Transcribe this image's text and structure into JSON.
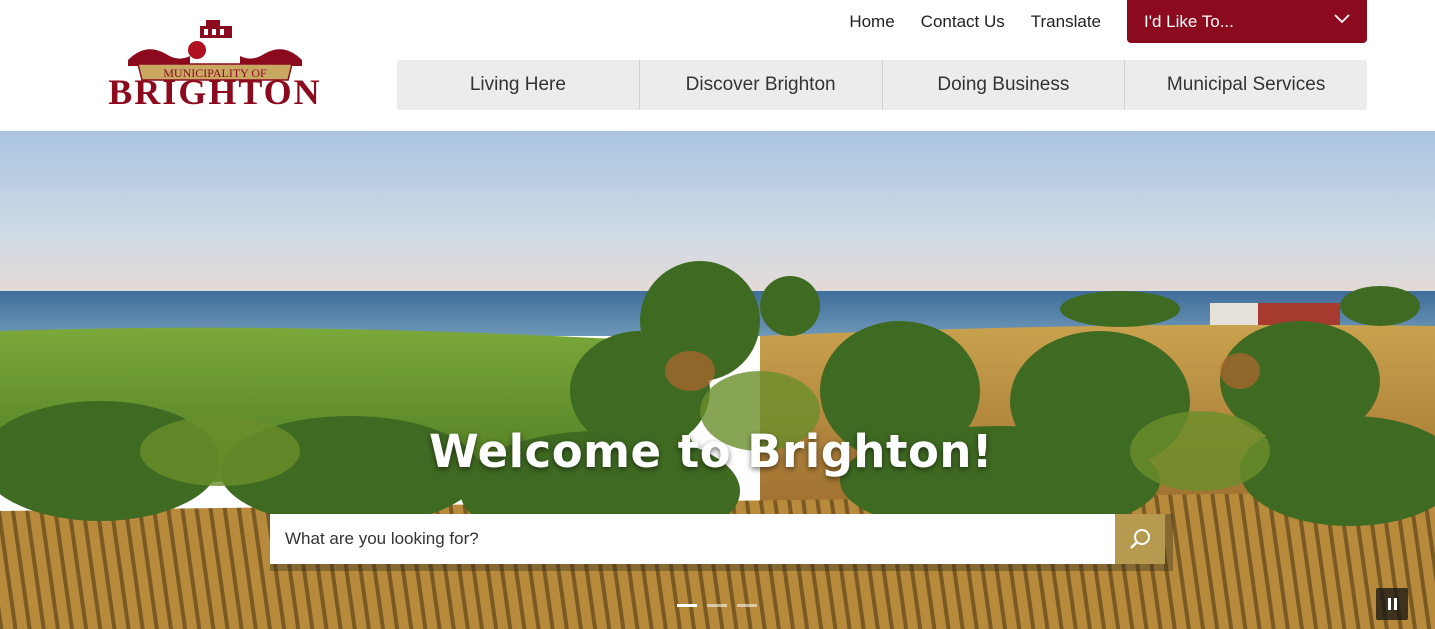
{
  "brand": {
    "logo_top": "MUNICIPALITY OF",
    "logo_name": "BRIGHTON",
    "brand_color": "#8c0a1e",
    "accent_color": "#b59a4f"
  },
  "utility_nav": {
    "links": [
      "Home",
      "Contact Us",
      "Translate"
    ],
    "dropdown_label": "I'd Like To...",
    "dropdown_icon": "chevron-down-icon"
  },
  "main_nav": {
    "items": [
      "Living Here",
      "Discover Brighton",
      "Doing Business",
      "Municipal Services"
    ]
  },
  "hero": {
    "title": "Welcome to Brighton!",
    "search_placeholder": "What are you looking for?",
    "search_icon": "search-icon",
    "slides_total": 3,
    "active_slide": 1,
    "pause_icon": "pause-icon"
  }
}
